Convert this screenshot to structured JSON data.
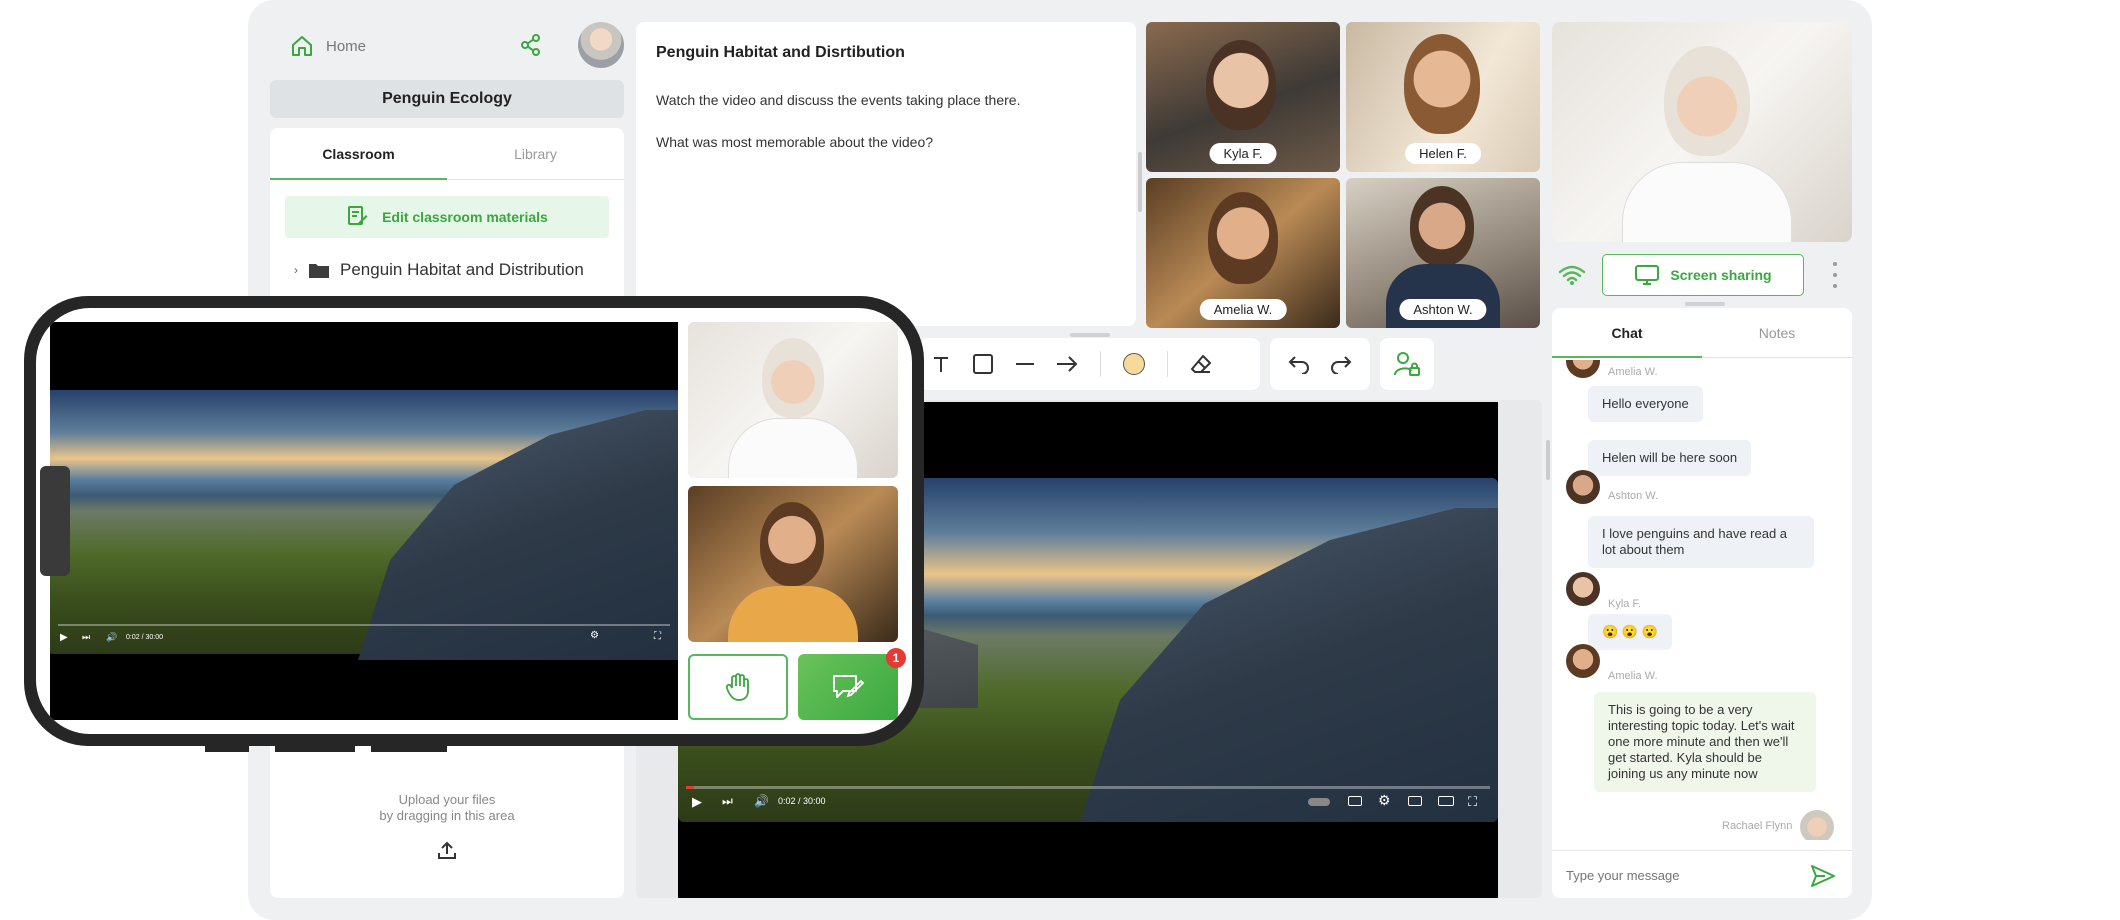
{
  "sidebar": {
    "home_label": "Home",
    "course_title": "Penguin Ecology",
    "tabs": [
      "Classroom",
      "Library"
    ],
    "edit_button": "Edit classroom materials",
    "folder_name": "Penguin Habitat and Distribution",
    "upload_line1": "Upload your files",
    "upload_line2": "by dragging in this area"
  },
  "document": {
    "title": "Penguin Habitat and Disrtibution",
    "paragraph1": "Watch the video and discuss the events taking place there.",
    "paragraph2": "What was most memorable about the video?"
  },
  "participants": [
    {
      "name": "Kyla F."
    },
    {
      "name": "Helen F."
    },
    {
      "name": "Amelia W."
    },
    {
      "name": "Ashton W."
    }
  ],
  "video_player": {
    "time_display": "0:02 / 30:00",
    "progress": 0.01
  },
  "host": {
    "screen_sharing_label": "Screen sharing"
  },
  "chat": {
    "tabs": [
      "Chat",
      "Notes"
    ],
    "messages": [
      {
        "author": "Amelia W.",
        "text": "Hello everyone"
      },
      {
        "author": "Ashton W.",
        "text": "Helen will be here soon"
      },
      {
        "author": "Kyla F.",
        "text": "I love penguins and have read a lot about them"
      },
      {
        "author": "Amelia W.",
        "text": "😮 😮 😮"
      },
      {
        "author": "Rachael Flynn",
        "text": "This is going to be a very interesting topic today. Let's wait one more minute and then we'll get started. Kyla should be joining us any minute now"
      }
    ],
    "authors_shown": [
      "Amelia W.",
      "Ashton W.",
      "Kyla F.",
      "Amelia W.",
      "Rachael Flynn"
    ],
    "input_placeholder": "Type your message"
  },
  "phone": {
    "chat_badge_count": "1"
  },
  "colors": {
    "accent_green": "#56b85a",
    "app_background": "#eef0f1",
    "badge_red": "#e53935"
  }
}
